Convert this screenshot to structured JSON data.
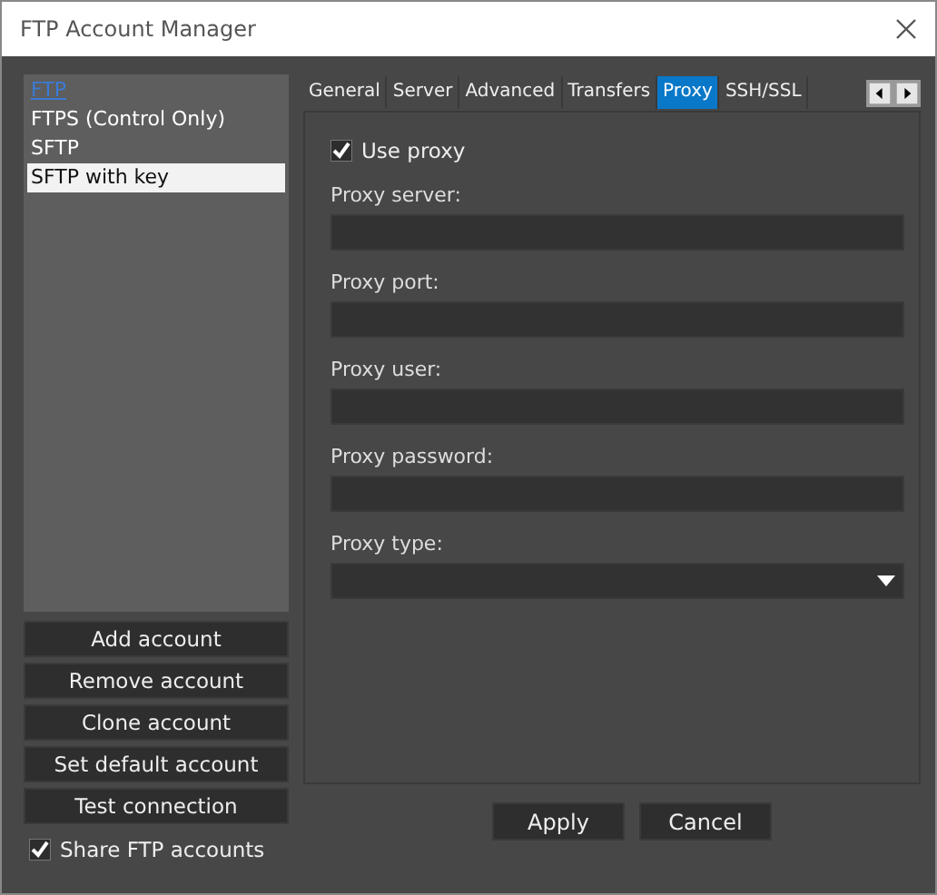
{
  "window": {
    "title": "FTP Account Manager"
  },
  "accounts": [
    {
      "label": "FTP",
      "selected": false,
      "default": true
    },
    {
      "label": "FTPS (Control Only)",
      "selected": false,
      "default": false
    },
    {
      "label": "SFTP",
      "selected": false,
      "default": false
    },
    {
      "label": "SFTP with key",
      "selected": true,
      "default": false
    }
  ],
  "account_buttons": [
    "Add account",
    "Remove account",
    "Clone account",
    "Set default account",
    "Test connection"
  ],
  "share_accounts": {
    "label": "Share FTP accounts",
    "checked": true
  },
  "tabs": [
    {
      "label": "General",
      "selected": false
    },
    {
      "label": "Server",
      "selected": false
    },
    {
      "label": "Advanced",
      "selected": false
    },
    {
      "label": "Transfers",
      "selected": false
    },
    {
      "label": "Proxy",
      "selected": true
    },
    {
      "label": "SSH/SSL",
      "selected": false
    }
  ],
  "use_proxy": {
    "label": "Use proxy",
    "checked": true
  },
  "fields": [
    {
      "label": "Proxy server:",
      "kind": "text"
    },
    {
      "label": "Proxy port:",
      "kind": "text"
    },
    {
      "label": "Proxy user:",
      "kind": "text"
    },
    {
      "label": "Proxy password:",
      "kind": "text"
    },
    {
      "label": "Proxy type:",
      "kind": "dropdown"
    }
  ],
  "buttons": [
    "Apply",
    "Cancel"
  ]
}
